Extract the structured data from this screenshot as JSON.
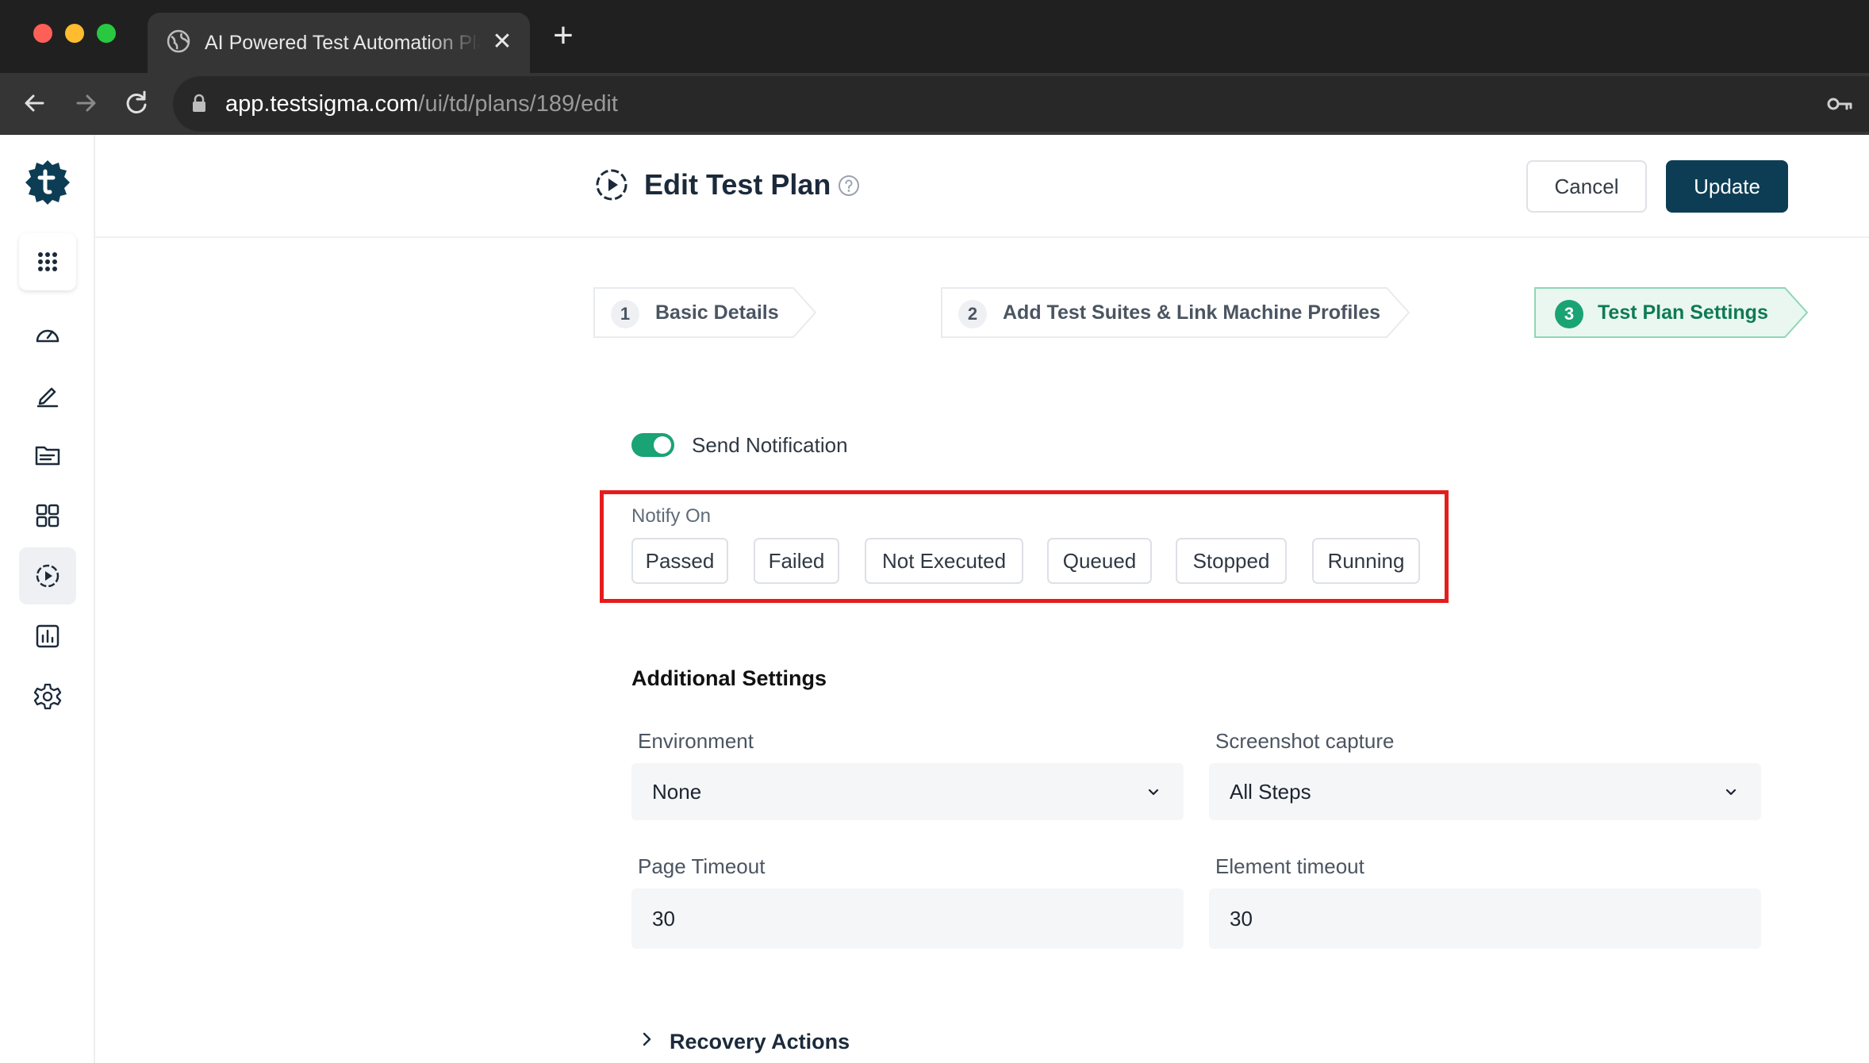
{
  "browser": {
    "tab_title": "AI Powered Test Automation Platform",
    "url_host": "app.testsigma.com",
    "url_path": "/ui/td/plans/189/edit"
  },
  "sidebar": {
    "items": [
      "apps-grid-icon",
      "dashboard-icon",
      "edit-icon",
      "folder-icon",
      "modules-icon",
      "test-plan-icon",
      "reports-icon",
      "settings-icon"
    ],
    "active": "test-plan-icon"
  },
  "header": {
    "title": "Edit Test Plan",
    "cancel_label": "Cancel",
    "update_label": "Update"
  },
  "steps": [
    {
      "number": "1",
      "label": "Basic Details"
    },
    {
      "number": "2",
      "label": "Add Test Suites & Link Machine Profiles"
    },
    {
      "number": "3",
      "label": "Test Plan Settings"
    }
  ],
  "notification": {
    "label": "Send Notification",
    "enabled": true,
    "notify_on_label": "Notify On",
    "options": [
      "Passed",
      "Failed",
      "Not Executed",
      "Queued",
      "Stopped",
      "Running"
    ]
  },
  "additional": {
    "title": "Additional Settings",
    "environment_label": "Environment",
    "environment_value": "None",
    "screenshot_label": "Screenshot capture",
    "screenshot_value": "All Steps",
    "page_timeout_label": "Page Timeout",
    "page_timeout_value": "30",
    "element_timeout_label": "Element timeout",
    "element_timeout_value": "30"
  },
  "recovery": {
    "label": "Recovery Actions"
  },
  "colors": {
    "accent": "#0c3d55",
    "success": "#1aa374",
    "highlight": "#e61c1c"
  }
}
